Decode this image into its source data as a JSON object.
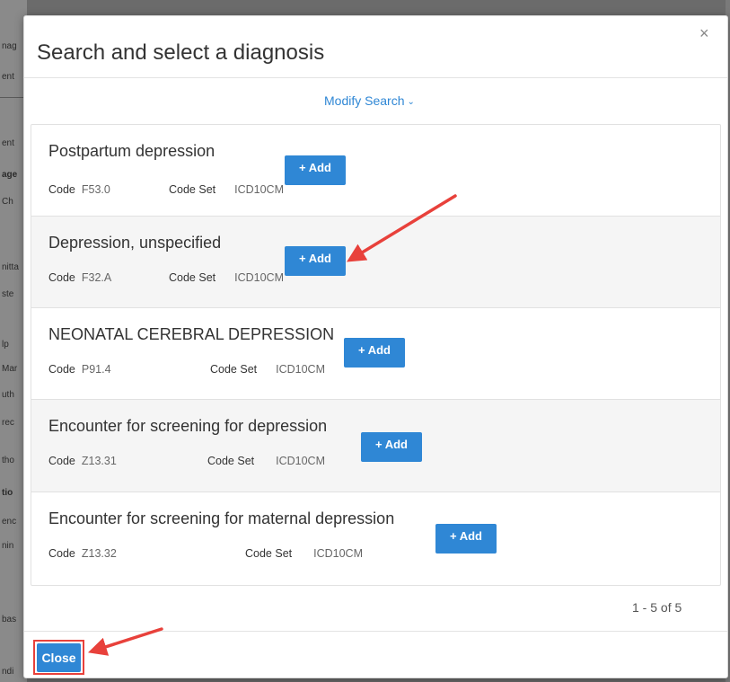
{
  "background": {
    "fragments": [
      "nag",
      "ent",
      "ent",
      "age",
      "Ch",
      "nitta",
      "ste",
      "lp",
      "Mar",
      "uth",
      "rec",
      "tho",
      "tio",
      "enc",
      "nin",
      "bas",
      "ndi"
    ]
  },
  "modal": {
    "title": "Search and select a diagnosis",
    "close_symbol": "×",
    "modify_search_label": "Modify Search",
    "modify_chevron": "⌄",
    "results": [
      {
        "name": "Postpartum depression",
        "code_label": "Code",
        "code": "F53.0",
        "code_set_label": "Code Set",
        "code_set": "ICD10CM",
        "add_label": "+ Add"
      },
      {
        "name": "Depression, unspecified",
        "code_label": "Code",
        "code": "F32.A",
        "code_set_label": "Code Set",
        "code_set": "ICD10CM",
        "add_label": "+ Add"
      },
      {
        "name": "NEONATAL CEREBRAL DEPRESSION",
        "code_label": "Code",
        "code": "P91.4",
        "code_set_label": "Code Set",
        "code_set": "ICD10CM",
        "add_label": "+ Add"
      },
      {
        "name": "Encounter for screening for depression",
        "code_label": "Code",
        "code": "Z13.31",
        "code_set_label": "Code Set",
        "code_set": "ICD10CM",
        "add_label": "+ Add"
      },
      {
        "name": "Encounter for screening for maternal depression",
        "code_label": "Code",
        "code": "Z13.32",
        "code_set_label": "Code Set",
        "code_set": "ICD10CM",
        "add_label": "+ Add"
      }
    ],
    "pagination": "1 - 5 of 5",
    "close_button_label": "Close"
  },
  "colors": {
    "accent": "#2f87d5",
    "annotation_red": "#e8413b"
  }
}
